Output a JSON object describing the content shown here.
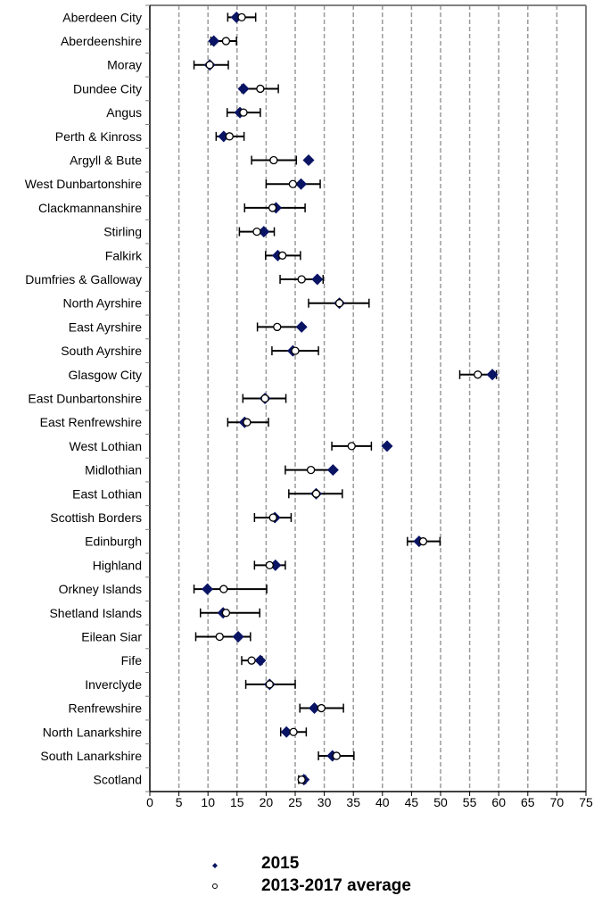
{
  "chart_data": {
    "type": "scatter",
    "orientation": "horizontal",
    "title": "",
    "xlabel": "",
    "ylabel": "",
    "xlim": [
      0,
      75
    ],
    "xticks": [
      0,
      5,
      10,
      15,
      20,
      25,
      30,
      35,
      40,
      45,
      50,
      55,
      60,
      65,
      70,
      75
    ],
    "grid": "vertical-dashed",
    "legend_position": "bottom-center",
    "colors": {
      "point_2015": "#0a1464",
      "average_fill": "#ffffff",
      "average_edge": "#000000",
      "error_bar": "#000000",
      "grid": "#9a9a9a",
      "axis": "#808080"
    },
    "legend": [
      {
        "name": "2015",
        "marker": "diamond"
      },
      {
        "name": "2013-2017 average",
        "marker": "circle",
        "has_error_bars": true
      }
    ],
    "categories": [
      "Aberdeen City",
      "Aberdeenshire",
      "Moray",
      "Dundee City",
      "Angus",
      "Perth & Kinross",
      "Argyll & Bute",
      "West Dunbartonshire",
      "Clackmannanshire",
      "Stirling",
      "Falkirk",
      "Dumfries & Galloway",
      "North Ayrshire",
      "East Ayrshire",
      "South Ayrshire",
      "Glasgow City",
      "East Dunbartonshire",
      "East Renfrewshire",
      "West Lothian",
      "Midlothian",
      "East Lothian",
      "Scottish Borders",
      "Edinburgh",
      "Highland",
      "Orkney Islands",
      "Shetland Islands",
      "Eilean Siar",
      "Fife",
      "Inverclyde",
      "Renfrewshire",
      "North Lanarkshire",
      "South Lanarkshire",
      "Scotland"
    ],
    "series": [
      {
        "name": "2015",
        "values": [
          14.9,
          11.0,
          10.3,
          16.1,
          15.5,
          12.7,
          27.3,
          26.0,
          21.7,
          19.6,
          22.0,
          28.8,
          32.6,
          26.1,
          24.6,
          58.9,
          19.8,
          16.3,
          40.8,
          31.5,
          28.6,
          21.5,
          46.3,
          21.6,
          9.9,
          12.6,
          15.2,
          19.0,
          20.6,
          28.3,
          23.5,
          31.4,
          26.5
        ]
      },
      {
        "name": "2013-2017 average",
        "values": [
          15.8,
          13.1,
          10.3,
          19.0,
          16.1,
          13.7,
          21.3,
          24.6,
          21.1,
          18.4,
          22.8,
          26.1,
          32.6,
          21.9,
          25.0,
          56.4,
          19.8,
          16.7,
          34.7,
          27.7,
          28.6,
          21.2,
          47.0,
          20.6,
          12.7,
          13.1,
          12.0,
          17.5,
          20.6,
          29.5,
          24.7,
          32.1,
          26.1
        ],
        "ci_low": [
          13.4,
          10.5,
          7.6,
          15.8,
          13.3,
          11.4,
          17.5,
          20.0,
          16.3,
          15.4,
          19.9,
          22.4,
          27.3,
          18.5,
          21.0,
          53.3,
          16.0,
          13.4,
          31.3,
          23.3,
          23.9,
          18.0,
          44.3,
          18.0,
          7.6,
          8.7,
          7.9,
          15.8,
          16.5,
          25.8,
          22.5,
          29.0,
          25.6
        ],
        "ci_high": [
          18.2,
          14.9,
          13.5,
          22.1,
          19.0,
          16.2,
          25.2,
          29.3,
          26.7,
          21.4,
          25.9,
          29.8,
          37.7,
          26.1,
          29.0,
          59.6,
          23.4,
          20.4,
          38.1,
          31.5,
          33.1,
          24.3,
          49.9,
          23.3,
          20.1,
          18.9,
          17.3,
          19.3,
          25.0,
          33.3,
          26.9,
          35.1,
          26.8
        ]
      }
    ]
  }
}
